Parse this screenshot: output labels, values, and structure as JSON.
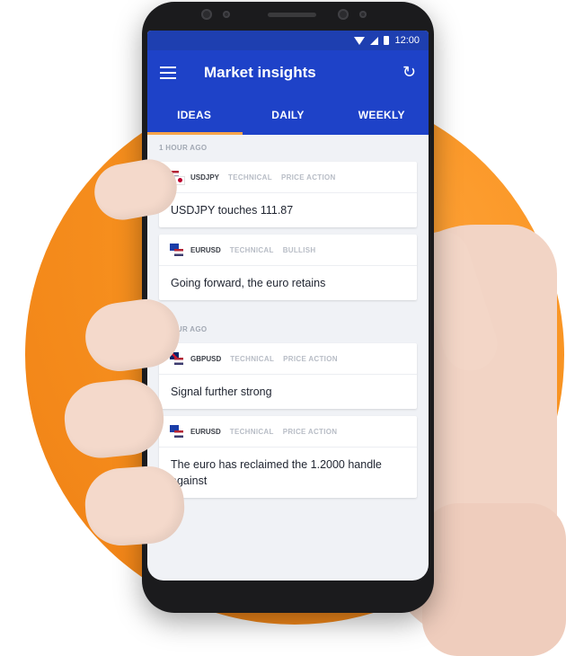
{
  "status_bar": {
    "time": "12:00"
  },
  "app_bar": {
    "title": "Market insights"
  },
  "tabs": [
    {
      "label": "IDEAS",
      "active": true
    },
    {
      "label": "DAILY",
      "active": false
    },
    {
      "label": "WEEKLY",
      "active": false
    }
  ],
  "sections": [
    {
      "label": "1 HOUR AGO",
      "cards": [
        {
          "pair": "USDJPY",
          "tags": [
            "TECHNICAL",
            "PRICE ACTION"
          ],
          "headline": "USDJPY touches 111.87"
        },
        {
          "pair": "EURUSD",
          "tags": [
            "TECHNICAL",
            "BULLISH"
          ],
          "headline": "Going forward, the euro retains"
        }
      ]
    },
    {
      "label": "8 HOUR AGO",
      "cards": [
        {
          "pair": "GBPUSD",
          "tags": [
            "TECHNICAL",
            "PRICE ACTION"
          ],
          "headline": "Signal further strong"
        },
        {
          "pair": "EURUSD",
          "tags": [
            "TECHNICAL",
            "PRICE ACTION"
          ],
          "headline": "The euro has reclaimed the 1.2000 handle against"
        }
      ]
    }
  ],
  "colors": {
    "brand_blue": "#1e42c8",
    "accent_orange": "#f7a44a",
    "background_orange": "#f7911f"
  }
}
